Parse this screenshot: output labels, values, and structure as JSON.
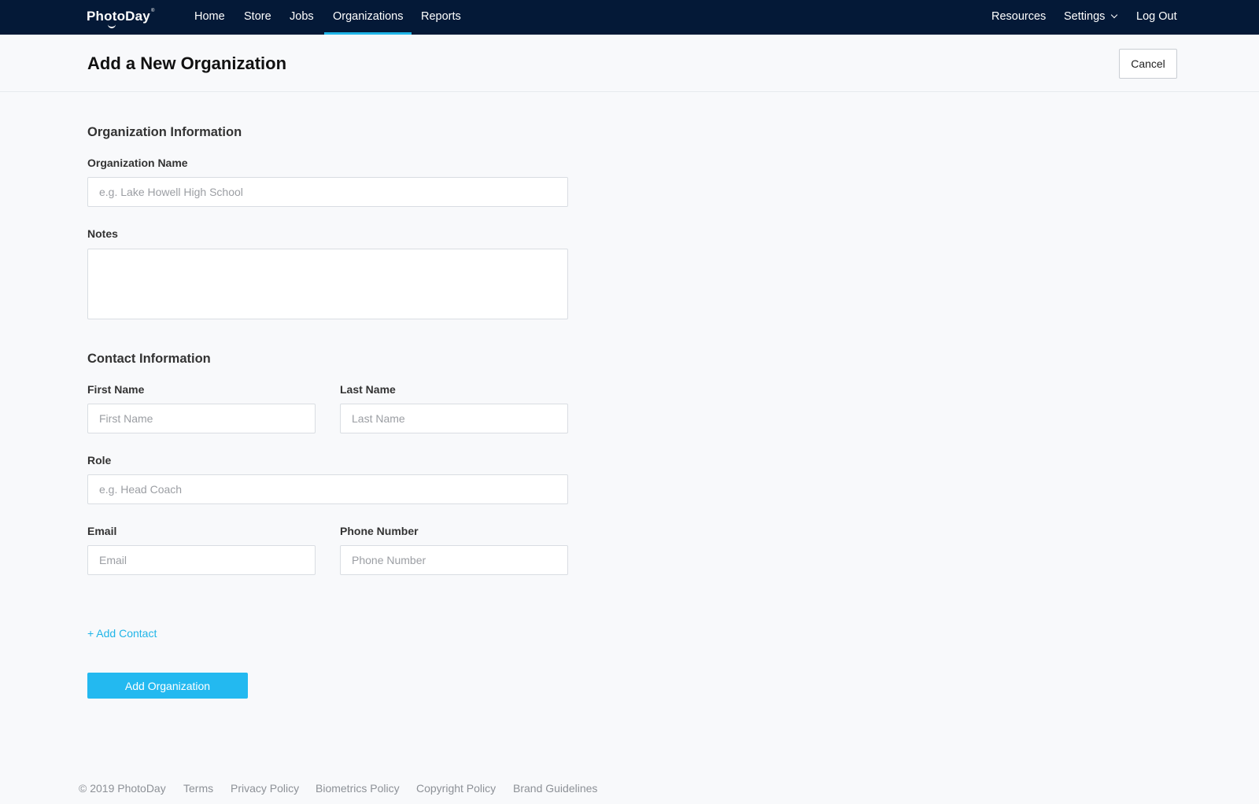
{
  "nav": {
    "logo": "PhotoDay",
    "logo_mark": "®",
    "items": [
      "Home",
      "Store",
      "Jobs",
      "Organizations",
      "Reports"
    ],
    "right": {
      "resources": "Resources",
      "settings": "Settings",
      "logout": "Log Out"
    }
  },
  "header": {
    "title": "Add a New Organization",
    "cancel": "Cancel"
  },
  "org_section": {
    "title": "Organization Information",
    "name_label": "Organization Name",
    "name_placeholder": "e.g. Lake Howell High School",
    "notes_label": "Notes"
  },
  "contact_section": {
    "title": "Contact Information",
    "first_name_label": "First Name",
    "first_name_placeholder": "First Name",
    "last_name_label": "Last Name",
    "last_name_placeholder": "Last Name",
    "role_label": "Role",
    "role_placeholder": "e.g. Head Coach",
    "email_label": "Email",
    "email_placeholder": "Email",
    "phone_label": "Phone Number",
    "phone_placeholder": "Phone Number"
  },
  "actions": {
    "add_contact": "+ Add Contact",
    "submit": "Add Organization"
  },
  "footer": {
    "copyright": "© 2019 PhotoDay",
    "links": [
      "Terms",
      "Privacy Policy",
      "Biometrics Policy",
      "Copyright Policy",
      "Brand Guidelines"
    ]
  },
  "colors": {
    "nav_bg": "#041937",
    "accent": "#20b5e8",
    "button": "#23b9f0"
  }
}
